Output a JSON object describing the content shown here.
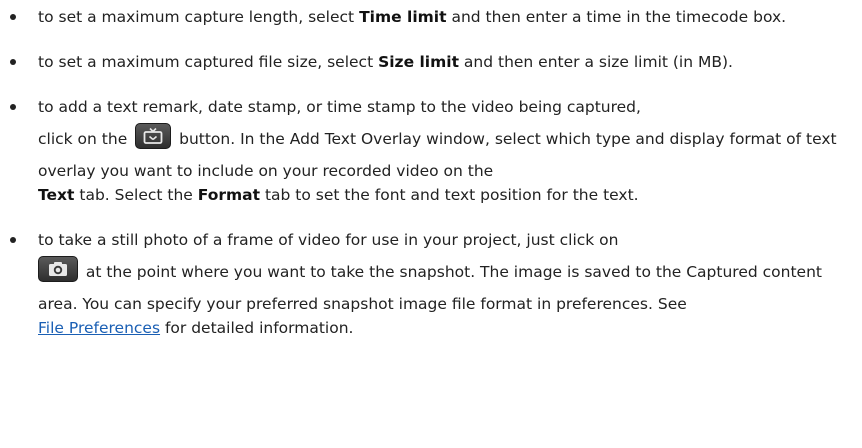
{
  "items": [
    {
      "pre": "to set a maximum capture length, select ",
      "bold": "Time limit",
      "post": " and then enter a time in the timecode box."
    },
    {
      "pre": "to set a maximum captured file size, select ",
      "bold": "Size limit",
      "post": " and then enter a size limit (in MB)."
    },
    {
      "line1": "to add a text remark, date stamp, or time stamp to the video being captured,",
      "pre": "click on the ",
      "icon": "tv-overlay-icon",
      "mid": " button. In the Add Text Overlay window, select which type and display format of text overlay you want to include on your recorded video on the ",
      "bold1": "Text",
      "mid2": " tab. Select the ",
      "bold2": "Format",
      "post": " tab to set the font and text position for the text."
    },
    {
      "line1": "to take a still photo of a frame of video for use in your project, just click on",
      "icon": "camera-icon",
      "mid": " at the point where you want to take the snapshot. The image is saved to the Captured content area. You can specify your preferred snapshot image file format in preferences. See ",
      "link": "File Preferences",
      "post": " for detailed information."
    }
  ]
}
